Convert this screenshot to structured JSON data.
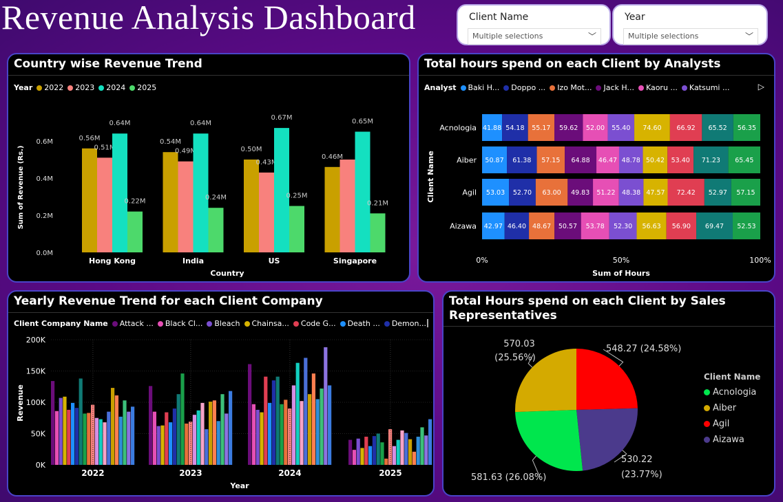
{
  "title": "Revenue Analysis Dashboard",
  "slicers": {
    "client": {
      "label": "Client Name",
      "value": "Multiple selections"
    },
    "year": {
      "label": "Year",
      "value": "Multiple selections"
    }
  },
  "colors": {
    "y2022": "#c9a000",
    "y2023": "#f8817d",
    "y2024": "#14e0c0",
    "y2025": "#4dd96b",
    "baki": "#1e90ff",
    "doppo": "#1f2fa8",
    "izo": "#e8713a",
    "jack": "#6b0d7a",
    "kaoru": "#e64fb5",
    "katsumi": "#7b4fd1",
    "a7": "#d7b300",
    "a8": "#e03e52",
    "a9": "#107a75",
    "a10": "#1aa04a",
    "acnologia": "#00e64d",
    "aiber": "#d4aa00",
    "agil": "#ff0000",
    "aizawa": "#4b3a8c"
  },
  "chart_data": [
    {
      "type": "bar",
      "title": "Country wise Revenue Trend",
      "xlabel": "Country",
      "ylabel": "Sum of Revenue (Rs.)",
      "legend_title": "Year",
      "categories": [
        "Hong Kong",
        "India",
        "US",
        "Singapore"
      ],
      "series": [
        {
          "name": "2022",
          "values": [
            0.56,
            0.54,
            0.5,
            0.46
          ],
          "labels": [
            "0.56M",
            "0.54M",
            "0.50M",
            "0.46M"
          ]
        },
        {
          "name": "2023",
          "values": [
            0.51,
            0.49,
            0.43,
            0.5
          ],
          "labels": [
            "0.51M",
            "0.49M",
            "0.43M",
            ""
          ]
        },
        {
          "name": "2024",
          "values": [
            0.64,
            0.64,
            0.67,
            0.65
          ],
          "labels": [
            "0.64M",
            "0.64M",
            "0.67M",
            "0.65M"
          ]
        },
        {
          "name": "2025",
          "values": [
            0.22,
            0.24,
            0.25,
            0.21
          ],
          "labels": [
            "0.22M",
            "0.24M",
            "0.25M",
            "0.21M"
          ]
        }
      ],
      "yticks": [
        "0.0M",
        "0.2M",
        "0.4M",
        "0.6M"
      ],
      "ylim": [
        0,
        0.7
      ],
      "legend_position": "top-left"
    },
    {
      "type": "bar",
      "stacked": "100%",
      "orientation": "horizontal",
      "title": "Total hours spend on each Client by Analysts",
      "xlabel": "Sum of Hours",
      "ylabel": "Client Name",
      "legend_title": "Analyst",
      "legend_visible": [
        "Baki H...",
        "Doppo ...",
        "Izo Mot...",
        "Jack H...",
        "Kaoru ...",
        "Katsumi ..."
      ],
      "xticks": [
        "0%",
        "50%",
        "100%"
      ],
      "categories": [
        "Acnologia",
        "Aiber",
        "Agil",
        "Aizawa"
      ],
      "segment_colors": [
        "#1e90ff",
        "#1f2fa8",
        "#e8713a",
        "#6b0d7a",
        "#e64fb5",
        "#7b4fd1",
        "#d7b300",
        "#e03e52",
        "#107a75",
        "#1aa04a"
      ],
      "rows": [
        [
          41.88,
          54.18,
          55.17,
          59.62,
          52.0,
          55.4,
          74.6,
          66.92,
          65.52,
          56.35
        ],
        [
          50.87,
          61.38,
          57.15,
          64.88,
          46.47,
          48.78,
          50.42,
          53.4,
          71.23,
          65.45
        ],
        [
          53.03,
          52.7,
          63.0,
          49.83,
          51.22,
          48.38,
          47.57,
          72.42,
          52.97,
          57.15
        ],
        [
          42.97,
          46.4,
          48.67,
          50.57,
          53.78,
          52.3,
          56.63,
          56.9,
          69.47,
          52.53
        ]
      ],
      "row_labels": [
        [
          "41.88",
          "54.18",
          "55.17",
          "59.62",
          "52.00",
          "55.40",
          "74.60",
          "66.92",
          "65.52",
          "56.35"
        ],
        [
          "50.87",
          "61.38",
          "57.15",
          "64.88",
          "46.47",
          "48.78",
          "50.42",
          "53.40",
          "71.23",
          "65.45"
        ],
        [
          "53.03",
          "52.70",
          "63.00",
          "49.83",
          "51.22",
          "48.38",
          "47.57",
          "72.42",
          "52.97",
          "57.15"
        ],
        [
          "42.97",
          "46.40",
          "48.67",
          "50.57",
          "53.78",
          "52.30",
          "56.63",
          "56.90",
          "69.47",
          "52.53"
        ]
      ]
    },
    {
      "type": "bar",
      "title": "Yearly Revenue Trend for each Client Company",
      "xlabel": "Year",
      "ylabel": "Revenue",
      "legend_title": "Client Company Name",
      "legend_visible": [
        "Attack ...",
        "Black Cl...",
        "Bleach",
        "Chainsa...",
        "Code G...",
        "Death ...",
        "Demon..."
      ],
      "categories": [
        "2022",
        "2023",
        "2024",
        "2025"
      ],
      "yticks": [
        "0K",
        "50K",
        "100K",
        "150K",
        "200K"
      ],
      "ylim": [
        0,
        200
      ],
      "bar_colors": [
        "#6b0d7a",
        "#e64fb5",
        "#7b4fd1",
        "#d7b300",
        "#e03e52",
        "#1e90ff",
        "#1f2fa8",
        "#107a75",
        "#1aa04a",
        "#e8713a",
        "#f8817d",
        "#d58ee3",
        "#12cfc0",
        "#f6a3c8",
        "#4a6fd8",
        "#c9a000",
        "#ff7f50",
        "#2f8fd8",
        "#3cc07a",
        "#8c73e0",
        "#3b7ce0"
      ],
      "groups": [
        [
          134,
          86,
          107,
          109,
          88,
          99,
          91,
          138,
          82,
          83,
          96,
          75,
          73,
          68,
          85,
          123,
          111,
          77,
          103,
          85,
          93
        ],
        [
          126,
          85,
          62,
          63,
          84,
          68,
          90,
          113,
          146,
          66,
          69,
          80,
          87,
          99,
          57,
          101,
          103,
          70,
          113,
          82,
          118
        ],
        [
          161,
          97,
          88,
          84,
          141,
          99,
          135,
          141,
          97,
          104,
          90,
          127,
          163,
          102,
          171,
          113,
          146,
          105,
          122,
          188,
          127
        ],
        [
          40,
          24,
          42,
          27,
          45,
          30,
          46,
          50,
          36,
          10,
          57,
          30,
          40,
          55,
          51,
          41,
          21,
          45,
          60,
          47,
          73
        ]
      ]
    },
    {
      "type": "pie",
      "title": "Total Hours spend on each Client by Sales Representatives",
      "legend_title": "Client Name",
      "slices": [
        {
          "name": "Acnologia",
          "value": 581.63,
          "label": "581.63 (26.08%)"
        },
        {
          "name": "Aiber",
          "value": 570.03,
          "label_line1": "570.03",
          "label_line2": "(25.56%)"
        },
        {
          "name": "Agil",
          "value": 548.27,
          "label": "548.27 (24.58%)"
        },
        {
          "name": "Aizawa",
          "value": 530.22,
          "label_line1": "530.22",
          "label_line2": "(23.77%)"
        }
      ]
    }
  ]
}
